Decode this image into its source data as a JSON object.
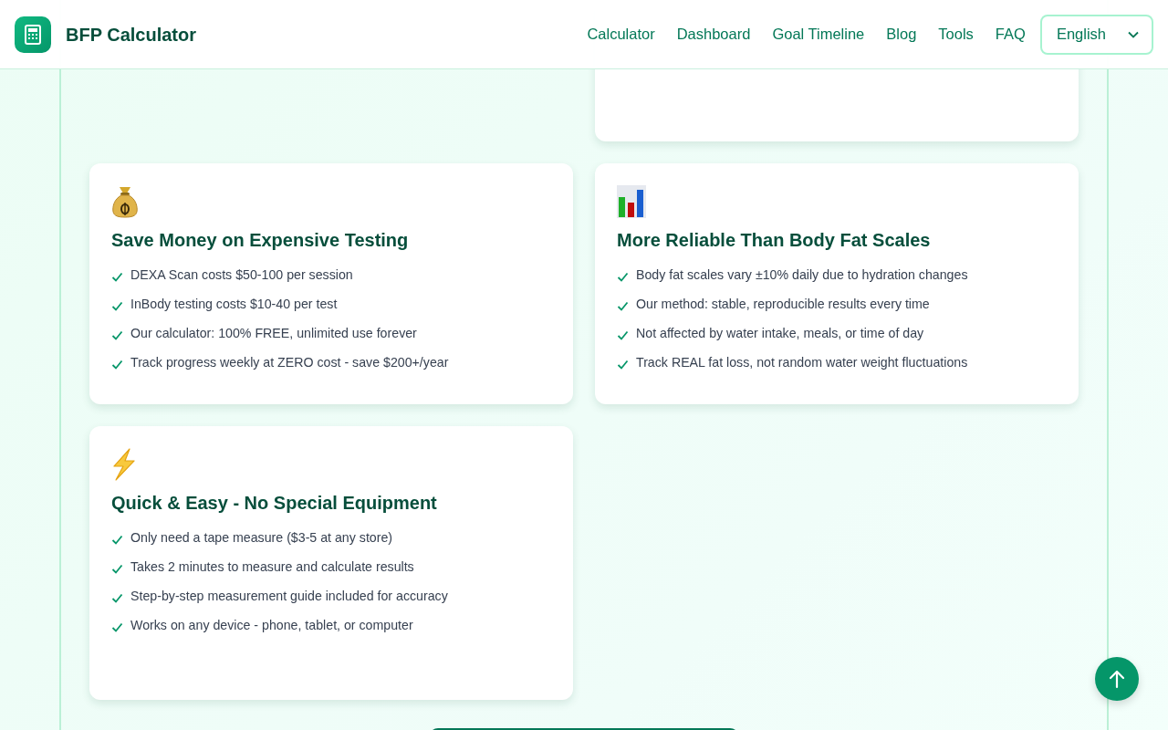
{
  "header": {
    "brand": "BFP Calculator",
    "nav_links": [
      "Calculator",
      "Dashboard",
      "Goal Timeline",
      "Blog",
      "Tools",
      "FAQ"
    ],
    "language": "English"
  },
  "feature_cards": [
    {
      "kind": "money-bag",
      "title": "Save Money on Expensive Testing",
      "points": [
        "DEXA Scan costs $50-100 per session",
        "InBody testing costs $10-40 per test",
        "Our calculator: 100% FREE, unlimited use forever",
        "Track progress weekly at ZERO cost - save $200+/year"
      ]
    },
    {
      "kind": "bar-chart",
      "title": "More Reliable Than Body Fat Scales",
      "points": [
        "Body fat scales vary ±10% daily due to hydration changes",
        "Our method: stable, reproducible results every time",
        "Not affected by water intake, meals, or time of day",
        "Track REAL fat loss, not random water weight fluctuations"
      ]
    },
    {
      "kind": "lightning",
      "title": "Quick & Easy - No Special Equipment",
      "points": [
        "Only need a tape measure ($3-5 at any store)",
        "Takes 2 minutes to measure and calculate results",
        "Step-by-step measurement guide included for accuracy",
        "Works on any device - phone, tablet, or computer"
      ]
    }
  ]
}
